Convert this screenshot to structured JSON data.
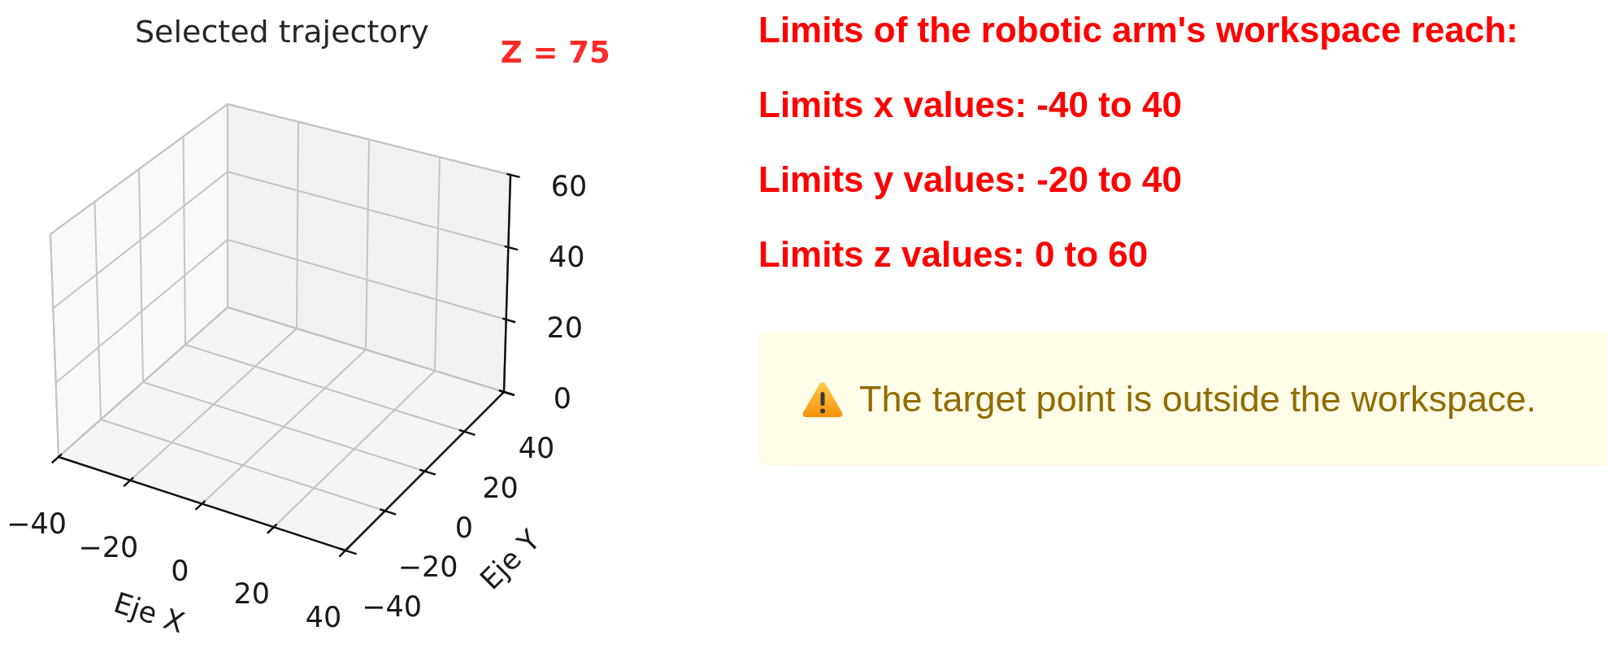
{
  "figure": {
    "title": "Selected trajectory",
    "z_readout": "Z = 75",
    "x_axis": {
      "label": "Eje X",
      "ticks": [
        "−40",
        "−20",
        "0",
        "20",
        "40"
      ]
    },
    "y_axis": {
      "label": "Eje Y",
      "ticks": [
        "−40",
        "−20",
        "0",
        "20",
        "40"
      ]
    },
    "z_axis": {
      "ticks": [
        "60",
        "40",
        "20",
        "0"
      ]
    }
  },
  "workspace_limits": {
    "heading": "Limits of the robotic arm's workspace reach:",
    "lines": [
      "Limits x values: -40 to 40",
      "Limits y values: -20 to 40",
      "Limits z values: 0 to 60"
    ]
  },
  "warning": {
    "message": "The target point is outside the workspace."
  }
}
